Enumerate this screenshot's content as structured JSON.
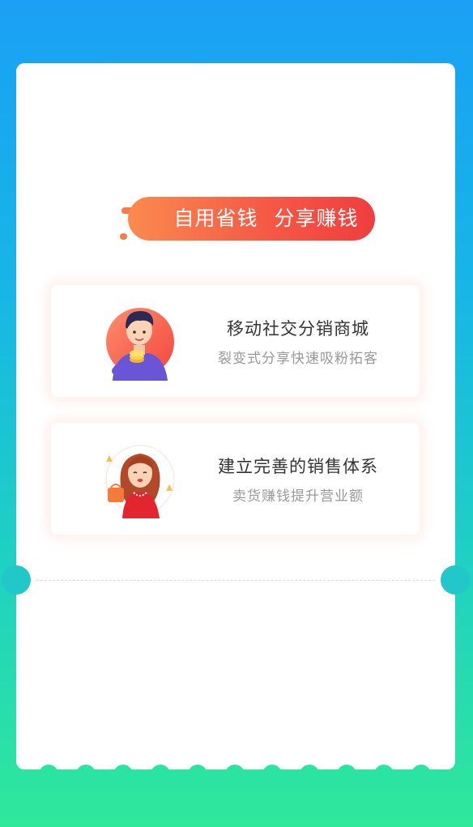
{
  "banner": {
    "slogan_1": "自用省钱",
    "slogan_2": "分享赚钱"
  },
  "features": [
    {
      "title": "移动社交分销商城",
      "description": "裂变式分享快速吸粉拓客",
      "icon": "man-holding-coins-icon"
    },
    {
      "title": "建立完善的销售体系",
      "description": "卖货赚钱提升营业额",
      "icon": "woman-with-shopping-bags-icon"
    }
  ],
  "colors": {
    "background_top": "#1aa0f5",
    "background_bottom": "#2fe89a",
    "banner_start": "#fb8a4f",
    "banner_end": "#ef3e3e",
    "title_text": "#333333",
    "description_text": "#999999"
  }
}
